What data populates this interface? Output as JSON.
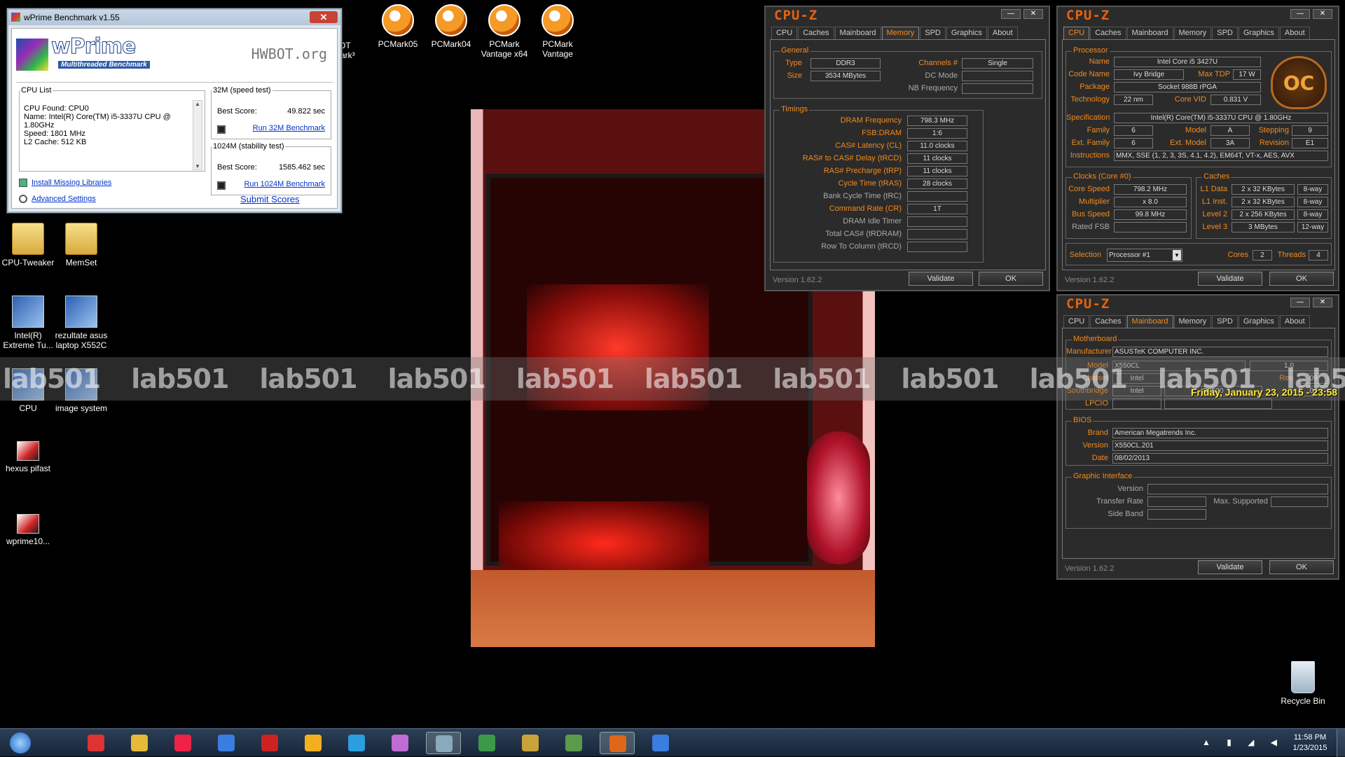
{
  "desktop": {
    "icons_left": [
      {
        "label": "CPU-Tweaker",
        "icon": "folder-icon"
      },
      {
        "label": "MemSet",
        "icon": "folder-icon"
      },
      {
        "label": "Intel(R) Extreme Tu...",
        "icon": "intel-xtu-icon"
      },
      {
        "label": "rezultate asus laptop X552C",
        "icon": "computer-icon"
      },
      {
        "label": "CPU",
        "icon": "cpu-icon"
      },
      {
        "label": "image system",
        "icon": "image-system-icon"
      },
      {
        "label": "hexus pifast",
        "icon": "pifast-icon"
      },
      {
        "label": "wprime10...",
        "icon": "wprime-icon"
      }
    ],
    "icons_top": [
      {
        "label": "HWBOT mark",
        "partial": "BOT",
        "partial2": "mark³"
      },
      {
        "label": "PCMark05"
      },
      {
        "label": "PCMark04"
      },
      {
        "label": "PCMark Vantage x64"
      },
      {
        "label": "PCMark Vantage"
      }
    ],
    "recycle_bin": "Recycle Bin",
    "watermark": "lab501",
    "clock_overlay": "Friday, January 23, 2015 - 23:58"
  },
  "wprime": {
    "title": "wPrime Benchmark v1.55",
    "logo": "wPrime",
    "subtitle": "Multithreaded Benchmark",
    "hwbot": "HWBOT.org",
    "cpu_list": {
      "legend": "CPU List",
      "lines": [
        "CPU Found: CPU0",
        "Name:   Intel(R) Core(TM) i5-3337U CPU @",
        "1.80GHz",
        "Speed:   1801 MHz",
        "L2 Cache: 512 KB"
      ]
    },
    "speed": {
      "legend": "32M (speed test)",
      "label": "Best Score:",
      "value": "49.822 sec",
      "run": "Run 32M Benchmark"
    },
    "stability": {
      "legend": "1024M (stability test)",
      "label": "Best Score:",
      "value": "1585.462 sec",
      "run": "Run 1024M Benchmark"
    },
    "links": {
      "install": "Install Missing Libraries",
      "advanced": "Advanced Settings",
      "submit": "Submit Scores"
    }
  },
  "cpuz_memory": {
    "title": "CPU-Z",
    "tabs": [
      "CPU",
      "Caches",
      "Mainboard",
      "Memory",
      "SPD",
      "Graphics",
      "About"
    ],
    "active_tab": "Memory",
    "general": {
      "legend": "General",
      "type_label": "Type",
      "type": "DDR3",
      "size_label": "Size",
      "size": "3534 MBytes",
      "channels_label": "Channels #",
      "channels": "Single",
      "dcmode_label": "DC Mode",
      "nbfreq_label": "NB Frequency"
    },
    "timings": {
      "legend": "Timings",
      "rows": [
        {
          "label": "DRAM Frequency",
          "value": "798.3 MHz",
          "orange": true
        },
        {
          "label": "FSB:DRAM",
          "value": "1:6",
          "orange": true
        },
        {
          "label": "CAS# Latency (CL)",
          "value": "11.0 clocks",
          "orange": true
        },
        {
          "label": "RAS# to CAS# Delay (tRCD)",
          "value": "11 clocks",
          "orange": true
        },
        {
          "label": "RAS# Precharge (tRP)",
          "value": "11 clocks",
          "orange": true
        },
        {
          "label": "Cycle Time (tRAS)",
          "value": "28 clocks",
          "orange": true
        },
        {
          "label": "Bank Cycle Time (tRC)",
          "value": "",
          "orange": false
        },
        {
          "label": "Command Rate (CR)",
          "value": "1T",
          "orange": true
        },
        {
          "label": "DRAM Idle Timer",
          "value": "",
          "orange": false
        },
        {
          "label": "Total CAS# (tRDRAM)",
          "value": "",
          "orange": false
        },
        {
          "label": "Row To Column (tRCD)",
          "value": "",
          "orange": false
        }
      ]
    },
    "version": "Version 1.62.2",
    "validate": "Validate",
    "ok": "OK"
  },
  "cpuz_cpu": {
    "title": "CPU-Z",
    "tabs": [
      "CPU",
      "Caches",
      "Mainboard",
      "Memory",
      "SPD",
      "Graphics",
      "About"
    ],
    "active_tab": "CPU",
    "processor": {
      "legend": "Processor",
      "name_label": "Name",
      "name": "Intel Core i5 3427U",
      "codename_label": "Code Name",
      "codename": "Ivy Bridge",
      "maxtdp_label": "Max TDP",
      "maxtdp": "17 W",
      "package_label": "Package",
      "package": "Socket 988B rPGA",
      "tech_label": "Technology",
      "tech": "22 nm",
      "vid_label": "Core VID",
      "vid": "0.831 V",
      "spec_label": "Specification",
      "spec": "Intel(R) Core(TM) i5-3337U CPU @ 1.80GHz",
      "family_label": "Family",
      "family": "6",
      "model_label": "Model",
      "model": "A",
      "stepping_label": "Stepping",
      "stepping": "9",
      "extfamily_label": "Ext. Family",
      "extfamily": "6",
      "extmodel_label": "Ext. Model",
      "extmodel": "3A",
      "revision_label": "Revision",
      "revision": "E1",
      "instr_label": "Instructions",
      "instr": "MMX, SSE (1, 2, 3, 3S, 4.1, 4.2), EM64T, VT-x, AES, AVX",
      "badge": "OC"
    },
    "clocks": {
      "legend": "Clocks (Core #0)",
      "speed_label": "Core Speed",
      "speed": "798.2 MHz",
      "mult_label": "Multiplier",
      "mult": "x 8.0",
      "bus_label": "Bus Speed",
      "bus": "99.8 MHz",
      "fsb_label": "Rated FSB"
    },
    "caches": {
      "legend": "Caches",
      "rows": [
        {
          "label": "L1 Data",
          "size": "2 x 32 KBytes",
          "way": "8-way"
        },
        {
          "label": "L1 Inst.",
          "size": "2 x 32 KBytes",
          "way": "8-way"
        },
        {
          "label": "Level 2",
          "size": "2 x 256 KBytes",
          "way": "8-way"
        },
        {
          "label": "Level 3",
          "size": "3 MBytes",
          "way": "12-way"
        }
      ]
    },
    "selection_label": "Selection",
    "selection": "Processor #1",
    "cores_label": "Cores",
    "cores": "2",
    "threads_label": "Threads",
    "threads": "4",
    "version": "Version 1.62.2",
    "validate": "Validate",
    "ok": "OK"
  },
  "cpuz_mainboard": {
    "title": "CPU-Z",
    "tabs": [
      "CPU",
      "Caches",
      "Mainboard",
      "Memory",
      "SPD",
      "Graphics",
      "About"
    ],
    "active_tab": "Mainboard",
    "motherboard": {
      "legend": "Motherboard",
      "mfr_label": "Manufacturer",
      "mfr": "ASUSTeK COMPUTER INC.",
      "model_label": "Model",
      "model": "X550CL",
      "model_rev": "1.0",
      "chipset_label": "Chipset",
      "chipset": "Intel",
      "chipset_rev_label": "Rev.",
      "chipset_rev": "09",
      "south_label": "Southbridge",
      "south": "Intel",
      "south_name": "B7520",
      "south_rev": "04",
      "lpcio_label": "LPCIO"
    },
    "bios": {
      "legend": "BIOS",
      "brand_label": "Brand",
      "brand": "American Megatrends Inc.",
      "version_label": "Version",
      "version": "X550CL.201",
      "date_label": "Date",
      "date": "08/02/2013"
    },
    "graphic": {
      "legend": "Graphic Interface",
      "version_label": "Version",
      "rate_label": "Transfer Rate",
      "max_label": "Max. Supported",
      "side_label": "Side Band"
    },
    "version": "Version 1.62.2",
    "validate": "Validate",
    "ok": "OK"
  },
  "taskbar": {
    "time": "11:58 PM",
    "date": "1/23/2015",
    "apps": [
      "start-orb-icon",
      "chrome-icon",
      "explorer-icon",
      "cpu-tweaker-icon",
      "intel-xtu-icon",
      "aida64-icon",
      "hwbot-icon",
      "xtu-icon",
      "lunar-icon",
      "screenshot-icon",
      "globe-icon",
      "image-icon",
      "monitor-icon",
      "cpuz-icon",
      "wprime-icon"
    ]
  },
  "colors": {
    "cpuz_orange": "#f28a1e",
    "cpuz_title": "#e8620e",
    "taskbar": "#1c2c40",
    "clock": "#ffec3a"
  }
}
